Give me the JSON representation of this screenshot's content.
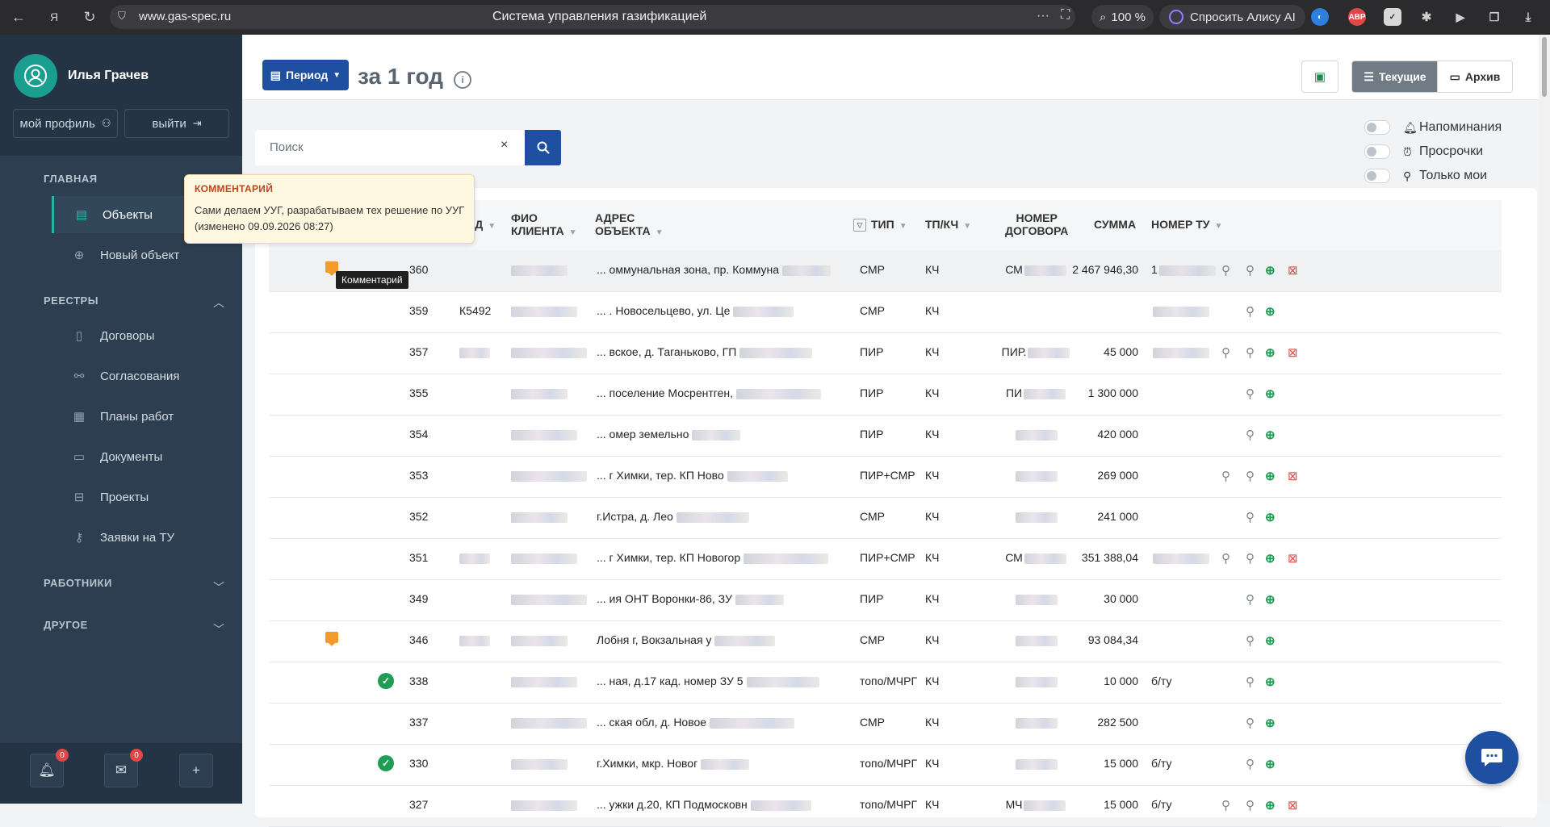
{
  "browser": {
    "url": "www.gas-spec.ru",
    "title": "Система управления газификацией",
    "zoom": "100 %",
    "alice": "Спросить Алису AI",
    "ext_abp": "ABP"
  },
  "sidebar": {
    "user_name": "Илья Грачев",
    "profile_btn": "мой профиль",
    "logout_btn": "выйти",
    "sections": {
      "main": "ГЛАВНАЯ",
      "registries": "РЕЕСТРЫ",
      "workers": "РАБОТНИКИ",
      "other": "ДРУГОЕ"
    },
    "items": {
      "objects": "Объекты",
      "new_object": "Новый объект",
      "contracts": "Договоры",
      "approvals": "Согласования",
      "work_plans": "Планы работ",
      "documents": "Документы",
      "projects": "Проекты",
      "tu_requests": "Заявки на ТУ"
    },
    "notif_count": "0",
    "mail_count": "0"
  },
  "header": {
    "period_btn": "Период",
    "title": "за 1 год",
    "tab_current": "Текущие",
    "tab_archive": "Архив"
  },
  "search": {
    "placeholder": "Поиск",
    "value": ""
  },
  "toggles": {
    "reminders": "Напоминания",
    "overdue": "Просрочки",
    "only_mine": "Только мои"
  },
  "tooltip": {
    "title": "КОММЕНТАРИЙ",
    "text": "Сами делаем УУГ, разрабатываем тех решение по УУГ (изменено 09.09.2026 08:27)",
    "mini": "Комментарий"
  },
  "table": {
    "headers": {
      "code": "КОД",
      "fio_1": "ФИО",
      "fio_2": "КЛИЕНТА",
      "addr_1": "АДРЕС",
      "addr_2": "ОБЪЕКТА",
      "type": "ТИП",
      "tp": "ТП/КЧ",
      "contract_1": "НОМЕР",
      "contract_2": "ДОГОВОРА",
      "sum": "СУММА",
      "tu": "НОМЕР ТУ"
    },
    "rows": [
      {
        "num": "360",
        "code": "",
        "addr": "... оммунальная зона, пр. Коммуна",
        "type": "СМР",
        "tp": "КЧ",
        "contract": "СМ",
        "sum": "2 467 946,30",
        "tu": "1"
      },
      {
        "num": "359",
        "code": "К5492",
        "addr": "... . Новосельцево, ул. Це",
        "type": "СМР",
        "tp": "КЧ",
        "contract": "",
        "sum": "",
        "tu": ""
      },
      {
        "num": "357",
        "code": "",
        "addr": "... вское, д. Таганьково, ГП",
        "type": "ПИР",
        "tp": "КЧ",
        "contract": "ПИР.",
        "sum": "45 000",
        "tu": ""
      },
      {
        "num": "355",
        "code": "",
        "addr": "... поселение Мосрентген,",
        "type": "ПИР",
        "tp": "КЧ",
        "contract": "ПИ",
        "sum": "1 300 000",
        "tu": ""
      },
      {
        "num": "354",
        "code": "",
        "addr": "... омер земельно",
        "type": "ПИР",
        "tp": "КЧ",
        "contract": "",
        "sum": "420 000",
        "tu": ""
      },
      {
        "num": "353",
        "code": "",
        "addr": "... г Химки, тер. КП Ново",
        "type": "ПИР+СМР",
        "tp": "КЧ",
        "contract": "",
        "sum": "269 000",
        "tu": ""
      },
      {
        "num": "352",
        "code": "",
        "addr": "г.Истра, д. Лео",
        "type": "СМР",
        "tp": "КЧ",
        "contract": "",
        "sum": "241 000",
        "tu": ""
      },
      {
        "num": "351",
        "code": "",
        "addr": "... г Химки, тер. КП Новогор",
        "type": "ПИР+СМР",
        "tp": "КЧ",
        "contract": "СМ",
        "sum": "351 388,04",
        "tu": ""
      },
      {
        "num": "349",
        "code": "",
        "addr": "... ия ОНТ Воронки-86, ЗУ",
        "type": "ПИР",
        "tp": "КЧ",
        "contract": "",
        "sum": "30 000",
        "tu": ""
      },
      {
        "num": "346",
        "code": "",
        "addr": "Лобня г, Вокзальная у",
        "type": "СМР",
        "tp": "КЧ",
        "contract": "",
        "sum": "93 084,34",
        "tu": ""
      },
      {
        "num": "338",
        "code": "",
        "addr": "... ная, д.17 кад. номер ЗУ 5",
        "type": "топо/МЧРГ",
        "tp": "КЧ",
        "contract": "",
        "sum": "10 000",
        "tu": "б/ту"
      },
      {
        "num": "337",
        "code": "",
        "addr": "... ская обл, д. Новое",
        "type": "СМР",
        "tp": "КЧ",
        "contract": "",
        "sum": "282 500",
        "tu": ""
      },
      {
        "num": "330",
        "code": "",
        "addr": "г.Химки, мкр. Новог",
        "type": "топо/МЧРГ",
        "tp": "КЧ",
        "contract": "",
        "sum": "15 000",
        "tu": "б/ту"
      },
      {
        "num": "327",
        "code": "",
        "addr": "... ужки д.20, КП Подмосковн",
        "type": "топо/МЧРГ",
        "tp": "КЧ",
        "contract": "МЧ",
        "sum": "15 000",
        "tu": "б/ту"
      }
    ]
  }
}
